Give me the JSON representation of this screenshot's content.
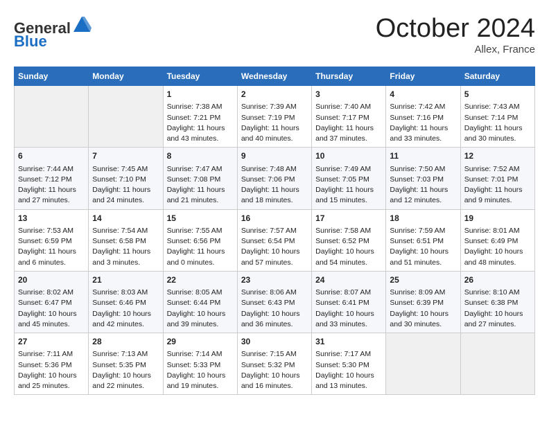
{
  "header": {
    "logo_line1": "General",
    "logo_line2": "Blue",
    "month": "October 2024",
    "location": "Allex, France"
  },
  "days_of_week": [
    "Sunday",
    "Monday",
    "Tuesday",
    "Wednesday",
    "Thursday",
    "Friday",
    "Saturday"
  ],
  "weeks": [
    [
      {
        "day": "",
        "sunrise": "",
        "sunset": "",
        "daylight": ""
      },
      {
        "day": "",
        "sunrise": "",
        "sunset": "",
        "daylight": ""
      },
      {
        "day": "1",
        "sunrise": "Sunrise: 7:38 AM",
        "sunset": "Sunset: 7:21 PM",
        "daylight": "Daylight: 11 hours and 43 minutes."
      },
      {
        "day": "2",
        "sunrise": "Sunrise: 7:39 AM",
        "sunset": "Sunset: 7:19 PM",
        "daylight": "Daylight: 11 hours and 40 minutes."
      },
      {
        "day": "3",
        "sunrise": "Sunrise: 7:40 AM",
        "sunset": "Sunset: 7:17 PM",
        "daylight": "Daylight: 11 hours and 37 minutes."
      },
      {
        "day": "4",
        "sunrise": "Sunrise: 7:42 AM",
        "sunset": "Sunset: 7:16 PM",
        "daylight": "Daylight: 11 hours and 33 minutes."
      },
      {
        "day": "5",
        "sunrise": "Sunrise: 7:43 AM",
        "sunset": "Sunset: 7:14 PM",
        "daylight": "Daylight: 11 hours and 30 minutes."
      }
    ],
    [
      {
        "day": "6",
        "sunrise": "Sunrise: 7:44 AM",
        "sunset": "Sunset: 7:12 PM",
        "daylight": "Daylight: 11 hours and 27 minutes."
      },
      {
        "day": "7",
        "sunrise": "Sunrise: 7:45 AM",
        "sunset": "Sunset: 7:10 PM",
        "daylight": "Daylight: 11 hours and 24 minutes."
      },
      {
        "day": "8",
        "sunrise": "Sunrise: 7:47 AM",
        "sunset": "Sunset: 7:08 PM",
        "daylight": "Daylight: 11 hours and 21 minutes."
      },
      {
        "day": "9",
        "sunrise": "Sunrise: 7:48 AM",
        "sunset": "Sunset: 7:06 PM",
        "daylight": "Daylight: 11 hours and 18 minutes."
      },
      {
        "day": "10",
        "sunrise": "Sunrise: 7:49 AM",
        "sunset": "Sunset: 7:05 PM",
        "daylight": "Daylight: 11 hours and 15 minutes."
      },
      {
        "day": "11",
        "sunrise": "Sunrise: 7:50 AM",
        "sunset": "Sunset: 7:03 PM",
        "daylight": "Daylight: 11 hours and 12 minutes."
      },
      {
        "day": "12",
        "sunrise": "Sunrise: 7:52 AM",
        "sunset": "Sunset: 7:01 PM",
        "daylight": "Daylight: 11 hours and 9 minutes."
      }
    ],
    [
      {
        "day": "13",
        "sunrise": "Sunrise: 7:53 AM",
        "sunset": "Sunset: 6:59 PM",
        "daylight": "Daylight: 11 hours and 6 minutes."
      },
      {
        "day": "14",
        "sunrise": "Sunrise: 7:54 AM",
        "sunset": "Sunset: 6:58 PM",
        "daylight": "Daylight: 11 hours and 3 minutes."
      },
      {
        "day": "15",
        "sunrise": "Sunrise: 7:55 AM",
        "sunset": "Sunset: 6:56 PM",
        "daylight": "Daylight: 11 hours and 0 minutes."
      },
      {
        "day": "16",
        "sunrise": "Sunrise: 7:57 AM",
        "sunset": "Sunset: 6:54 PM",
        "daylight": "Daylight: 10 hours and 57 minutes."
      },
      {
        "day": "17",
        "sunrise": "Sunrise: 7:58 AM",
        "sunset": "Sunset: 6:52 PM",
        "daylight": "Daylight: 10 hours and 54 minutes."
      },
      {
        "day": "18",
        "sunrise": "Sunrise: 7:59 AM",
        "sunset": "Sunset: 6:51 PM",
        "daylight": "Daylight: 10 hours and 51 minutes."
      },
      {
        "day": "19",
        "sunrise": "Sunrise: 8:01 AM",
        "sunset": "Sunset: 6:49 PM",
        "daylight": "Daylight: 10 hours and 48 minutes."
      }
    ],
    [
      {
        "day": "20",
        "sunrise": "Sunrise: 8:02 AM",
        "sunset": "Sunset: 6:47 PM",
        "daylight": "Daylight: 10 hours and 45 minutes."
      },
      {
        "day": "21",
        "sunrise": "Sunrise: 8:03 AM",
        "sunset": "Sunset: 6:46 PM",
        "daylight": "Daylight: 10 hours and 42 minutes."
      },
      {
        "day": "22",
        "sunrise": "Sunrise: 8:05 AM",
        "sunset": "Sunset: 6:44 PM",
        "daylight": "Daylight: 10 hours and 39 minutes."
      },
      {
        "day": "23",
        "sunrise": "Sunrise: 8:06 AM",
        "sunset": "Sunset: 6:43 PM",
        "daylight": "Daylight: 10 hours and 36 minutes."
      },
      {
        "day": "24",
        "sunrise": "Sunrise: 8:07 AM",
        "sunset": "Sunset: 6:41 PM",
        "daylight": "Daylight: 10 hours and 33 minutes."
      },
      {
        "day": "25",
        "sunrise": "Sunrise: 8:09 AM",
        "sunset": "Sunset: 6:39 PM",
        "daylight": "Daylight: 10 hours and 30 minutes."
      },
      {
        "day": "26",
        "sunrise": "Sunrise: 8:10 AM",
        "sunset": "Sunset: 6:38 PM",
        "daylight": "Daylight: 10 hours and 27 minutes."
      }
    ],
    [
      {
        "day": "27",
        "sunrise": "Sunrise: 7:11 AM",
        "sunset": "Sunset: 5:36 PM",
        "daylight": "Daylight: 10 hours and 25 minutes."
      },
      {
        "day": "28",
        "sunrise": "Sunrise: 7:13 AM",
        "sunset": "Sunset: 5:35 PM",
        "daylight": "Daylight: 10 hours and 22 minutes."
      },
      {
        "day": "29",
        "sunrise": "Sunrise: 7:14 AM",
        "sunset": "Sunset: 5:33 PM",
        "daylight": "Daylight: 10 hours and 19 minutes."
      },
      {
        "day": "30",
        "sunrise": "Sunrise: 7:15 AM",
        "sunset": "Sunset: 5:32 PM",
        "daylight": "Daylight: 10 hours and 16 minutes."
      },
      {
        "day": "31",
        "sunrise": "Sunrise: 7:17 AM",
        "sunset": "Sunset: 5:30 PM",
        "daylight": "Daylight: 10 hours and 13 minutes."
      },
      {
        "day": "",
        "sunrise": "",
        "sunset": "",
        "daylight": ""
      },
      {
        "day": "",
        "sunrise": "",
        "sunset": "",
        "daylight": ""
      }
    ]
  ]
}
